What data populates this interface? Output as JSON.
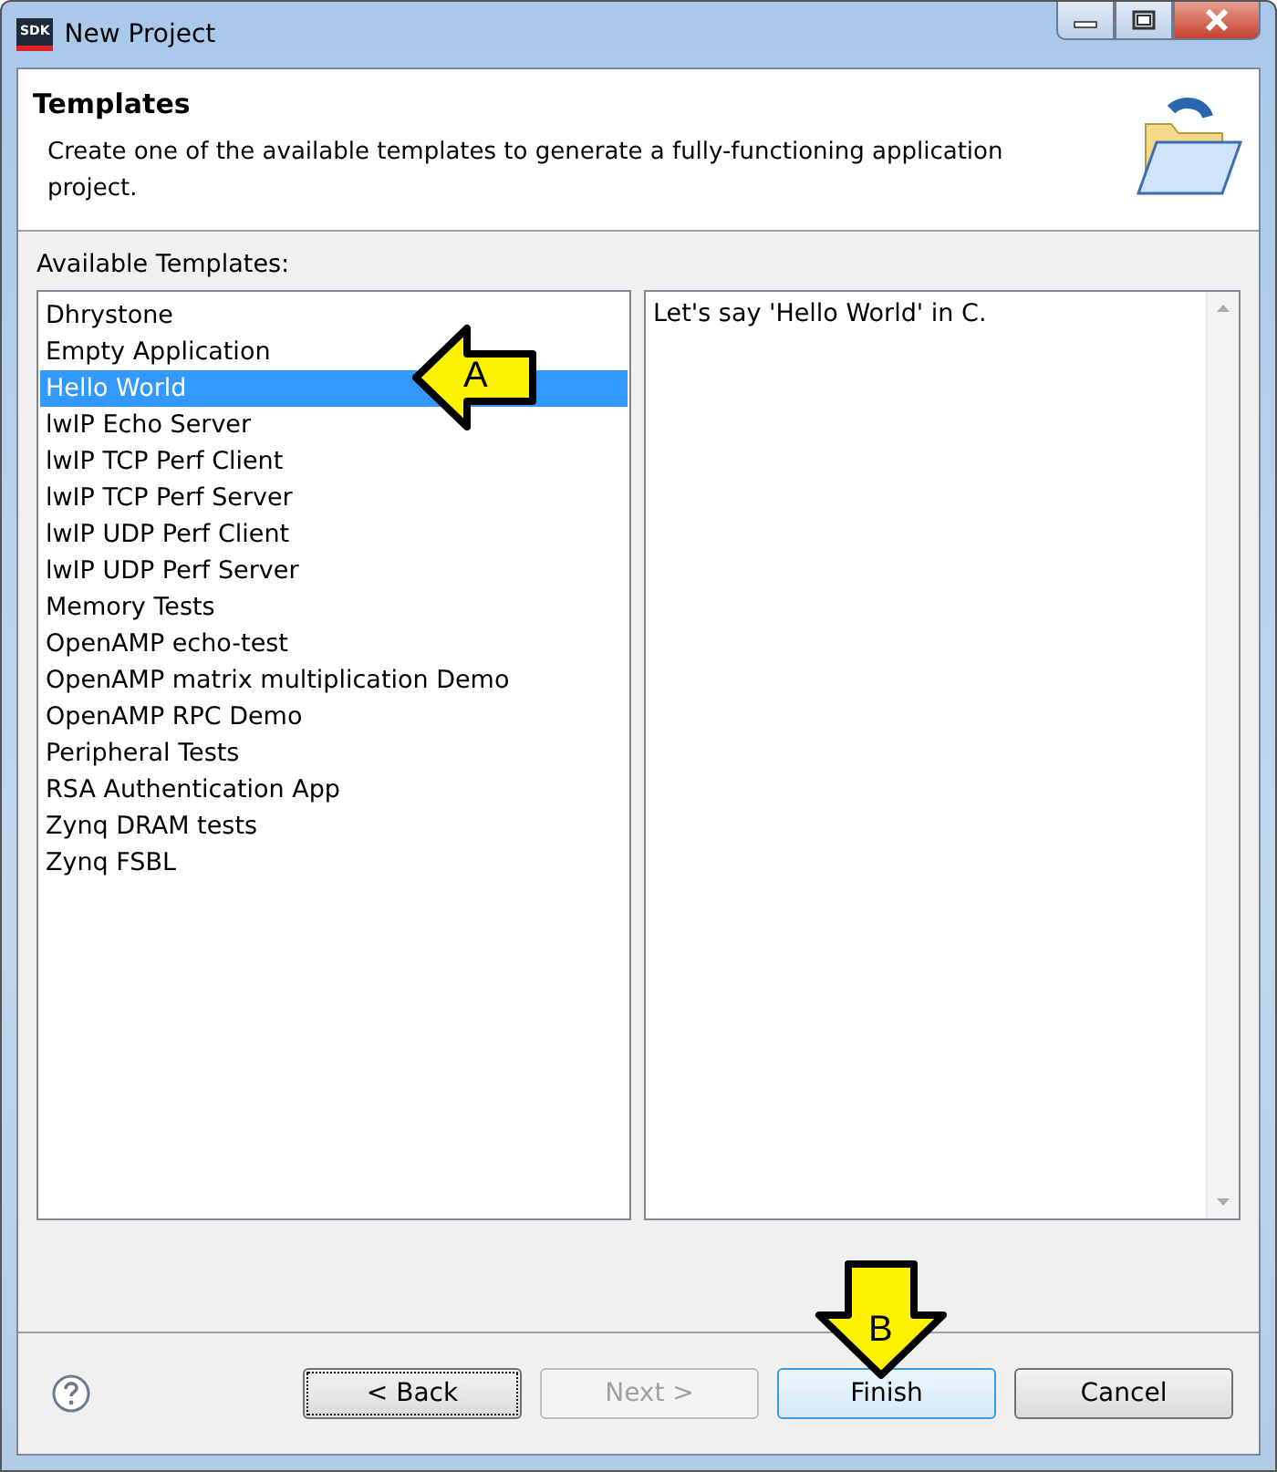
{
  "window": {
    "title": "New Project",
    "app_badge": "SDK"
  },
  "header": {
    "title": "Templates",
    "description": "Create one of the available templates to generate a fully-functioning application project."
  },
  "templates_label": "Available Templates:",
  "templates": [
    {
      "label": "Dhrystone",
      "selected": false
    },
    {
      "label": "Empty Application",
      "selected": false
    },
    {
      "label": "Hello World",
      "selected": true
    },
    {
      "label": "lwIP Echo Server",
      "selected": false
    },
    {
      "label": "lwIP TCP Perf Client",
      "selected": false
    },
    {
      "label": "lwIP TCP Perf Server",
      "selected": false
    },
    {
      "label": "lwIP UDP Perf Client",
      "selected": false
    },
    {
      "label": "lwIP UDP Perf Server",
      "selected": false
    },
    {
      "label": "Memory Tests",
      "selected": false
    },
    {
      "label": "OpenAMP echo-test",
      "selected": false
    },
    {
      "label": "OpenAMP matrix multiplication Demo",
      "selected": false
    },
    {
      "label": "OpenAMP RPC Demo",
      "selected": false
    },
    {
      "label": "Peripheral Tests",
      "selected": false
    },
    {
      "label": "RSA Authentication App",
      "selected": false
    },
    {
      "label": "Zynq DRAM tests",
      "selected": false
    },
    {
      "label": "Zynq FSBL",
      "selected": false
    }
  ],
  "description_text": "Let's say 'Hello World' in C.",
  "buttons": [
    {
      "label": "< Back",
      "kind": "focused",
      "disabled": false
    },
    {
      "label": "Next >",
      "kind": "normal",
      "disabled": true
    },
    {
      "label": "Finish",
      "kind": "default",
      "disabled": false
    },
    {
      "label": "Cancel",
      "kind": "normal",
      "disabled": false
    }
  ],
  "callouts": [
    {
      "label": "A",
      "kind": "left"
    },
    {
      "label": "B",
      "kind": "down"
    }
  ]
}
